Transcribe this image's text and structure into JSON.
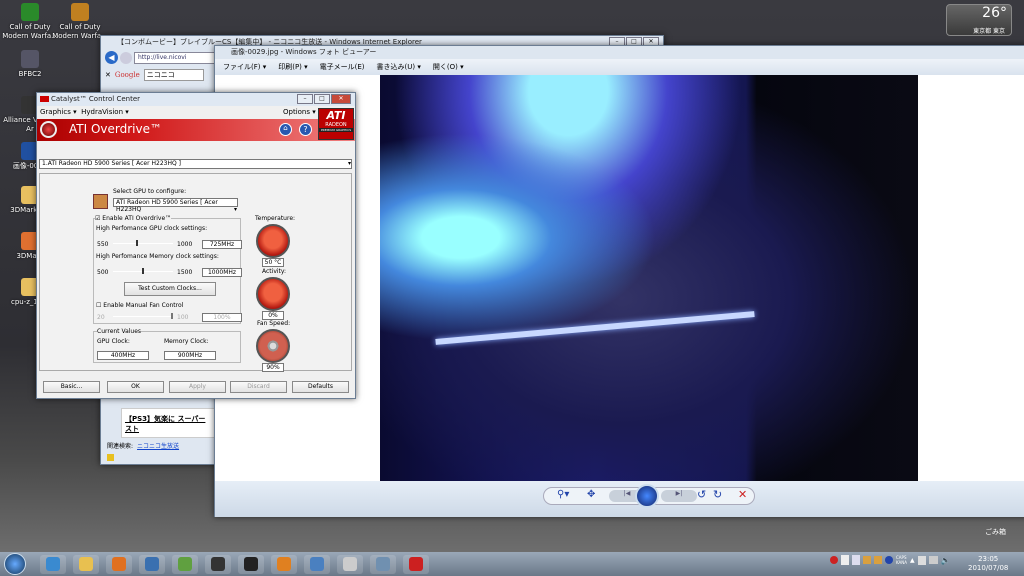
{
  "desktop": {
    "icons": [
      {
        "label": "Call of Duty Modern Warfa...",
        "color": "#2a8a2a"
      },
      {
        "label": "Call of Duty Modern Warfa...",
        "color": "#c08020"
      },
      {
        "label": "BFBC2",
        "color": "#556"
      },
      {
        "label": "Alliance Valiant Ar",
        "color": "#333"
      },
      {
        "label": "画像-0029",
        "color": "#2050a0"
      },
      {
        "label": "3DMark06_",
        "color": "#e8c060"
      },
      {
        "label": "3DMark",
        "color": "#e07030"
      },
      {
        "label": "cpu-z_1.54",
        "color": "#e8c060"
      }
    ],
    "weather": {
      "temp": "26°",
      "location": "東京都 東京"
    },
    "recycle_bin": "ごみ箱"
  },
  "ie": {
    "title": "【コンボムービー】ブレイブルーCS【編集中】 - ニコニコ生放送 - Windows Internet Explorer",
    "url": "http://live.nicovi",
    "search_engine": "Google",
    "search_value": "ニコニコ",
    "article": "【PS3】気楽に スーパースト",
    "related_label": "関連検索:",
    "related_link": "ニコニコ生放送"
  },
  "photo": {
    "title": "画像-0029.jpg - Windows フォト ビューアー",
    "menu": [
      "ファイル(F) ▾",
      "印刷(P) ▾",
      "電子メール(E)",
      "書き込み(U) ▾",
      "開く(O) ▾"
    ]
  },
  "ccc": {
    "title": "Catalyst™ Control Center",
    "menu": [
      "Graphics ▾",
      "HydraVision ▾"
    ],
    "options": "Options ▾",
    "header": "ATI Overdrive™",
    "brand": "ATI",
    "brand_sub": "RADEON",
    "brand_sub2": "PREMIUM GRAPHICS",
    "adapter": "1.ATI Radeon HD 5900 Series [ Acer H223HQ ]",
    "select_gpu_label": "Select GPU to configure:",
    "select_gpu": "ATI Radeon HD 5900 Series [ Acer H223HQ",
    "enable_overdrive": "Enable ATI Overdrive™",
    "gpu_clock_label": "High Perfomance GPU clock settings:",
    "gpu_min": "550",
    "gpu_max": "1000",
    "gpu_value": "725MHz",
    "gpu_fraction": 0.39,
    "mem_clock_label": "High Perfomance Memory clock settings:",
    "mem_min": "500",
    "mem_max": "1500",
    "mem_value": "1000MHz",
    "mem_fraction": 0.5,
    "test_button": "Test Custom Clocks...",
    "manual_fan": "Enable Manual Fan Control",
    "fan_min": "20",
    "fan_max": "100",
    "fan_value": "100%",
    "current_values": "Current Values",
    "gpu_clock": "GPU Clock:",
    "gpu_clock_value": "400MHz",
    "mem_clock": "Memory Clock:",
    "mem_clock_value": "900MHz",
    "temperature_label": "Temperature:",
    "temperature": "50 °C",
    "activity_label": "Activity:",
    "activity": "0%",
    "fanspeed_label": "Fan Speed:",
    "fanspeed": "90%",
    "buttons": {
      "basic": "Basic...",
      "ok": "OK",
      "apply": "Apply",
      "discard": "Discard",
      "defaults": "Defaults"
    }
  },
  "taskbar": {
    "tray_caps": "CAPS",
    "tray_kana": "KANA",
    "time": "23:05",
    "date": "2010/07/08",
    "apps": [
      "#3a8ad0",
      "#e8c050",
      "#e07020",
      "#3a70b0",
      "#60a040",
      "#333",
      "#222",
      "#e08020",
      "#4a80c0",
      "#ccc",
      "#7090b0",
      "#cc2020"
    ]
  }
}
